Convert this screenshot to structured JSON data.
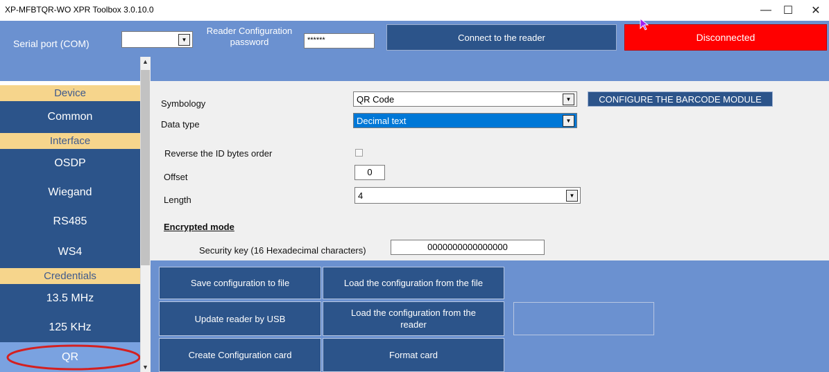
{
  "window": {
    "title": "XP-MFBTQR-WO  XPR Toolbox 3.0.10.0",
    "minimize": "—",
    "maximize": "☐",
    "close": "✕"
  },
  "topbar": {
    "serial_port_label": "Serial port (COM)",
    "serial_port_value": "",
    "password_label": "Reader Configuration password",
    "password_value": "******",
    "connect_label": "Connect to the reader",
    "status_label": "Disconnected",
    "status_color": "#ff0000"
  },
  "sidebar": {
    "sections": [
      {
        "title": "Device",
        "items": [
          "Common"
        ]
      },
      {
        "title": "Interface",
        "items": [
          "OSDP",
          "Wiegand",
          "RS485",
          "WS4"
        ]
      },
      {
        "title": "Credentials",
        "items": [
          "13.5 MHz",
          "125 KHz",
          "QR"
        ]
      }
    ],
    "selected": "QR",
    "highlight_color": "#d42020"
  },
  "form": {
    "symbology_label": "Symbology",
    "symbology_value": "QR Code",
    "configure_button": "CONFIGURE THE BARCODE MODULE",
    "data_type_label": "Data type",
    "data_type_value": "Decimal text",
    "reverse_label": "Reverse the ID bytes order",
    "reverse_checked": false,
    "offset_label": "Offset",
    "offset_value": "0",
    "length_label": "Length",
    "length_value": "4",
    "encrypted_heading": "Encrypted mode",
    "security_key_label": "Security key (16 Hexadecimal characters)",
    "security_key_value": "0000000000000000"
  },
  "actions": {
    "save_file": "Save configuration to file",
    "load_file": "Load the configuration from the file",
    "update_usb": "Update reader by USB",
    "load_reader": "Load the configuration from the reader",
    "create_card": "Create Configuration card",
    "format_card": "Format card"
  }
}
